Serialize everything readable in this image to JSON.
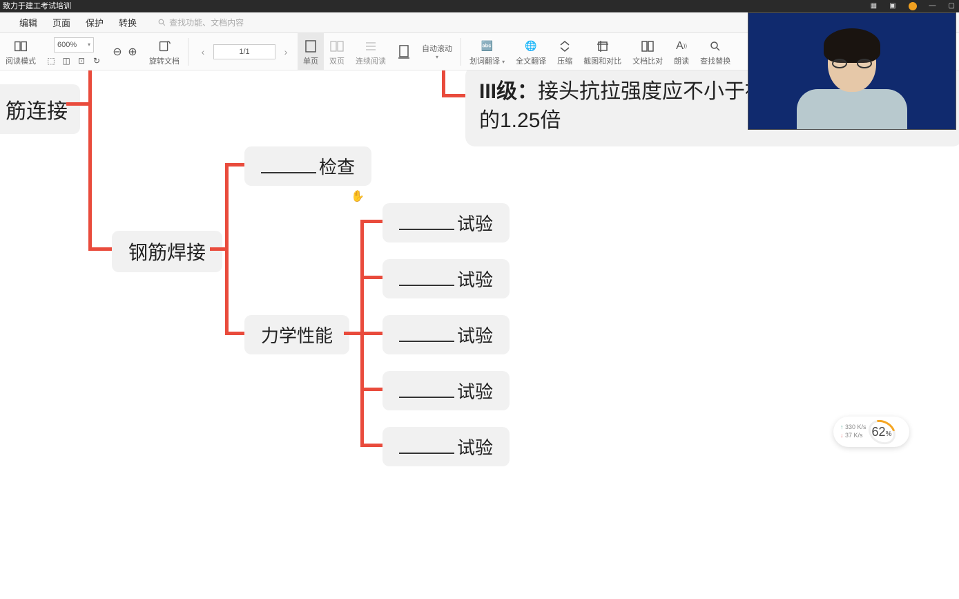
{
  "titlebar": {
    "text": "致力于建工考试培训"
  },
  "menu": {
    "items": [
      "",
      "编辑",
      "页面",
      "保护",
      "转换"
    ],
    "search_placeholder": "查找功能、文档内容"
  },
  "toolbar": {
    "reading_mode": "阅读模式",
    "zoom_value": "600%",
    "rotate": "旋转文档",
    "single_page": "单页",
    "double_page": "双页",
    "continuous": "连续阅读",
    "page_current": "1/1",
    "frame": "",
    "auto_scroll": "自动滚动",
    "word_translate": "划词翻译",
    "full_translate": "全文翻译",
    "compress": "压缩",
    "screenshot": "截图和对比",
    "doc_compare": "文档比对",
    "read_aloud": "朗读",
    "find_replace": "查找替换"
  },
  "mindmap": {
    "root": "筋连接",
    "node_weld": "钢筋焊接",
    "node_check_suffix": "检查",
    "node_mech": "力学性能",
    "test_suffix": "试验",
    "callout_line1_prefix": "III级：",
    "callout_line1_rest": "接头抗拉强度应不小于被",
    "callout_line2": "的1.25倍"
  },
  "net": {
    "up": "330 K/s",
    "down": "37  K/s",
    "pct": "62",
    "pct_unit": "%"
  }
}
